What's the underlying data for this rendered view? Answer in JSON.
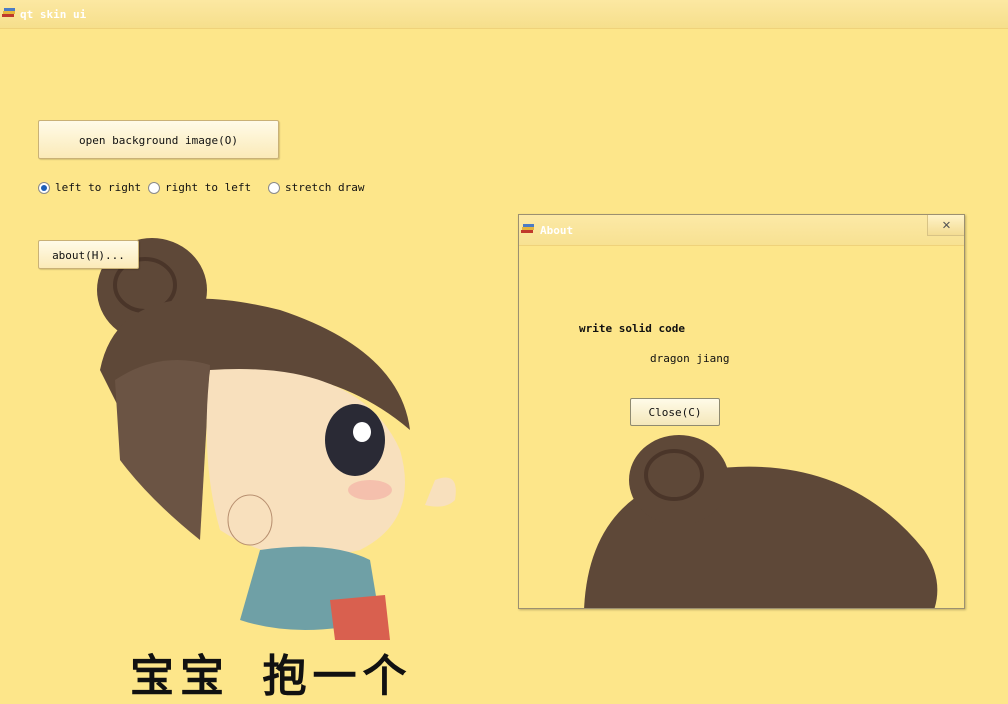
{
  "window": {
    "title": "qt skin ui",
    "icon": "book-icon"
  },
  "main": {
    "open_button_label": "open background image(O)",
    "radios": [
      {
        "label": "left to right",
        "checked": true
      },
      {
        "label": "right to left",
        "checked": false
      },
      {
        "label": "stretch draw",
        "checked": false
      }
    ],
    "about_button_label": "about(H)...",
    "background_text": "宝宝 抱一个"
  },
  "about_dialog": {
    "title": "About",
    "icon": "book-icon",
    "close_icon": "close-icon",
    "heading": "write solid code",
    "author": "dragon jiang",
    "close_button_label": "Close(C)"
  },
  "colors": {
    "background": "#fde68a",
    "title_text": "#ffffff",
    "hair": "#5b4636",
    "radio_checked": "#1d5fb8"
  }
}
